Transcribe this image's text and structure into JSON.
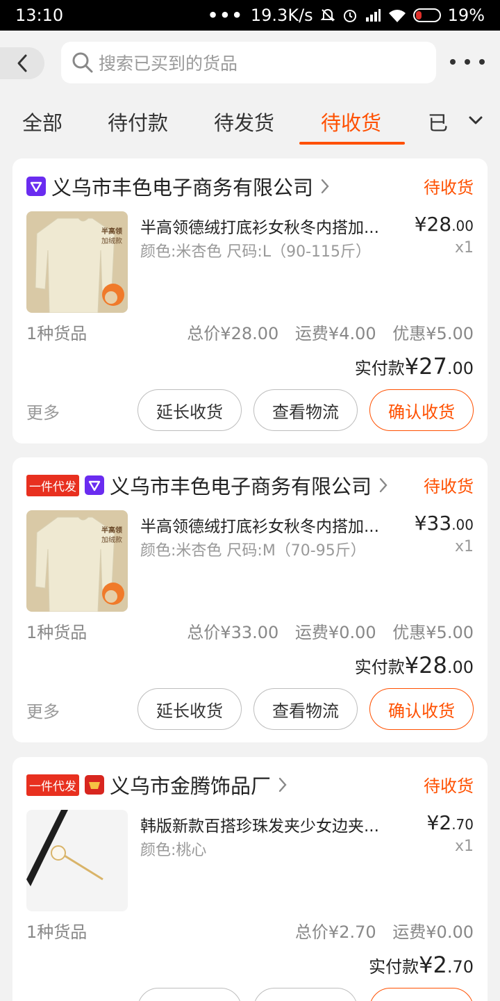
{
  "status_bar": {
    "time": "13:10",
    "dots": "•••",
    "network_speed": "19.3K/s",
    "battery": "19%"
  },
  "search": {
    "placeholder": "搜索已买到的货品"
  },
  "tabs": [
    {
      "label": "全部"
    },
    {
      "label": "待付款"
    },
    {
      "label": "待发货"
    },
    {
      "label": "待收货"
    },
    {
      "label": "已"
    }
  ],
  "labels": {
    "more": "更多",
    "paid_prefix": "实付款",
    "extend_button": "延长收货",
    "logistics_button": "查看物流",
    "confirm_button": "确认收货",
    "daifa_tag": "一件代发"
  },
  "orders": [
    {
      "shop_name": "义乌市丰色电子商务有限公司",
      "status": "待收货",
      "title": "半高领德绒打底衫女秋冬内搭加...",
      "spec": "颜色:米杏色 尺码:L（90-115斤）",
      "price_int": "¥28",
      "price_dec": ".00",
      "qty": "x1",
      "count": "1种货品",
      "total": "总价¥28.00",
      "shipping": "运费¥4.00",
      "discount": "优惠¥5.00",
      "paid_int": "¥27",
      "paid_dec": ".00"
    },
    {
      "shop_name": "义乌市丰色电子商务有限公司",
      "status": "待收货",
      "title": "半高领德绒打底衫女秋冬内搭加...",
      "spec": "颜色:米杏色 尺码:M（70-95斤）",
      "price_int": "¥33",
      "price_dec": ".00",
      "qty": "x1",
      "count": "1种货品",
      "total": "总价¥33.00",
      "shipping": "运费¥0.00",
      "discount": "优惠¥5.00",
      "paid_int": "¥28",
      "paid_dec": ".00"
    },
    {
      "shop_name": "义乌市金腾饰品厂",
      "status": "待收货",
      "title": "韩版新款百搭珍珠发夹少女边夹...",
      "spec": "颜色:桃心",
      "price_int": "¥2",
      "price_dec": ".70",
      "qty": "x1",
      "count": "1种货品",
      "total": "总价¥2.70",
      "shipping": "运费¥0.00",
      "paid_int": "¥2",
      "paid_dec": ".70"
    }
  ],
  "thumb_text": "半高领 加绒款 修身显瘦百搭",
  "colors": {
    "accent": "#ff5000",
    "tag_red": "#e8301f",
    "badge_purple": "#6a2cf0"
  }
}
